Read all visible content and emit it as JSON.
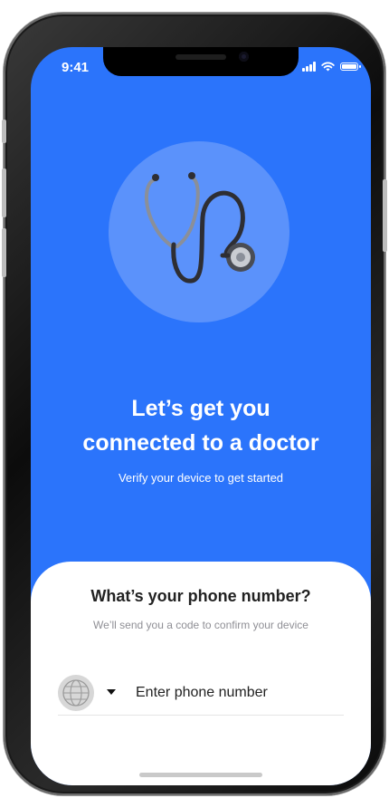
{
  "status_bar": {
    "time": "9:41",
    "icons": [
      "signal-icon",
      "wifi-icon",
      "battery-icon"
    ]
  },
  "hero": {
    "icon": "stethoscope-icon",
    "title_line1": "Let’s get you",
    "title_line2": "connected to a doctor",
    "subtitle": "Verify your device to get started"
  },
  "phone_sheet": {
    "title": "What’s your phone number?",
    "subtitle": "We’ll send you a code to confirm your device",
    "country_icon": "globe-icon",
    "dropdown_icon": "caret-down-icon",
    "phone_placeholder": "Enter phone number",
    "phone_value": ""
  },
  "colors": {
    "accent": "#2b74fb",
    "hero_circle": "#5b92fb",
    "sheet_background": "#ffffff",
    "muted_text": "#8f8f95"
  }
}
